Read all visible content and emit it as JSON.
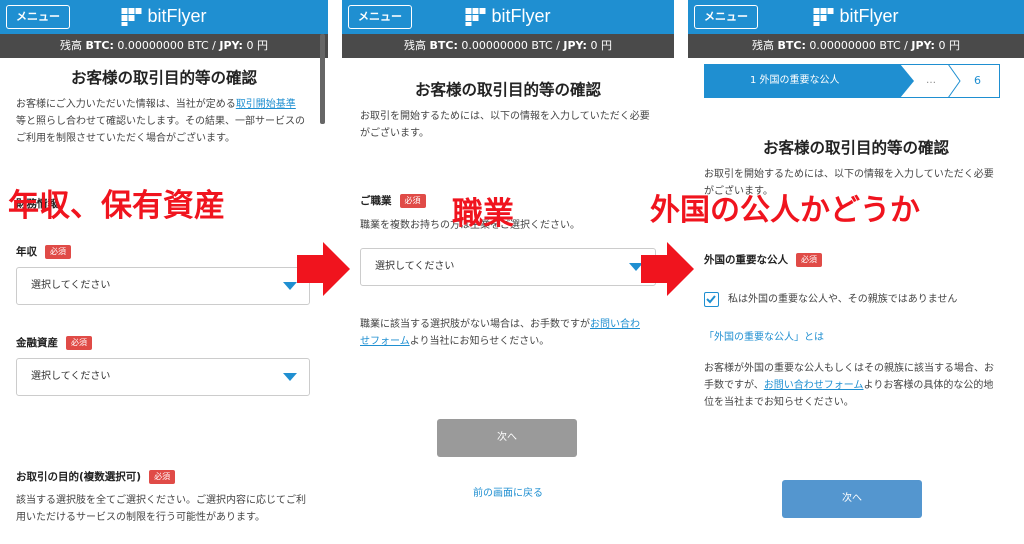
{
  "header": {
    "menu_label": "メニュー",
    "logo_text": "bitFlyer"
  },
  "balance": {
    "prefix": "残高",
    "btc_label": "BTC:",
    "btc_value": "0.00000000 BTC",
    "sep": "/",
    "jpy_label": "JPY:",
    "jpy_value": "0 円"
  },
  "page_title": "お客様の取引目的等の確認",
  "required_badge": "必須",
  "panel1": {
    "intro_a": "お客様にご入力いただいた情報は、当社が定める",
    "intro_link": "取引開始基準",
    "intro_b": "等と照らし合わせて確認いたします。その結果、一部サービスの",
    "intro_c": "ご利用を制限させていただく場合がございます。",
    "section_heading": "財務情報",
    "income_label": "年収",
    "income_value": "選択してください",
    "assets_label": "金融資産",
    "assets_value": "選択してください",
    "purpose_label": "お取引の目的(複数選択可)",
    "purpose_desc_a": "該当する選択肢を全てご選択ください。ご選択内容に応じてご利",
    "purpose_desc_b": "用いただけるサービスの制限を行う可能性があります。"
  },
  "panel2": {
    "intro_a": "お取引を開始するためには、以下の情報を入力していただく必要",
    "intro_b": "がございます。",
    "occupation_label": "ご職業",
    "occupation_hint": "職業を複数お持ちの方は主業をご選択ください。",
    "occupation_value": "選択してください",
    "note_a": "職業に該当する選択肢がない場合は、お手数ですが",
    "note_link_a": "お問い合わ",
    "note_link_b": "せフォーム",
    "note_b": "より当社にお知らせください。",
    "next_label": "次へ",
    "back_label": "前の画面に戻る"
  },
  "panel3": {
    "step_current": "1 外国の重要な公人",
    "step_dots": "…",
    "step_last": "6",
    "intro_a": "お取引を開始するためには、以下の情報を入力していただく必要",
    "intro_b": "がございます。",
    "pep_label": "外国の重要な公人",
    "checkbox_label": "私は外国の重要な公人や、その親族ではありません",
    "pep_link": "「外国の重要な公人」とは",
    "note_a": "お客様が外国の重要な公人もしくはその親族に該当する場合、お",
    "note_b_pre": "手数ですが、",
    "note_link": "お問い合わせフォーム",
    "note_b_post": "よりお客様の具体的な公的地",
    "note_c": "位を当社までお知らせください。",
    "next_label": "次へ"
  },
  "overlays": {
    "label1": "年収、保有資産",
    "label2": "職業",
    "label3": "外国の公人かどうか",
    "color": "#f0141e"
  },
  "colors": {
    "brand": "#1f8fd1",
    "balance_bar": "#4a4a4a",
    "required": "#e04b47",
    "disabled_button": "#9a9a9a",
    "active_button": "#5496cf"
  }
}
